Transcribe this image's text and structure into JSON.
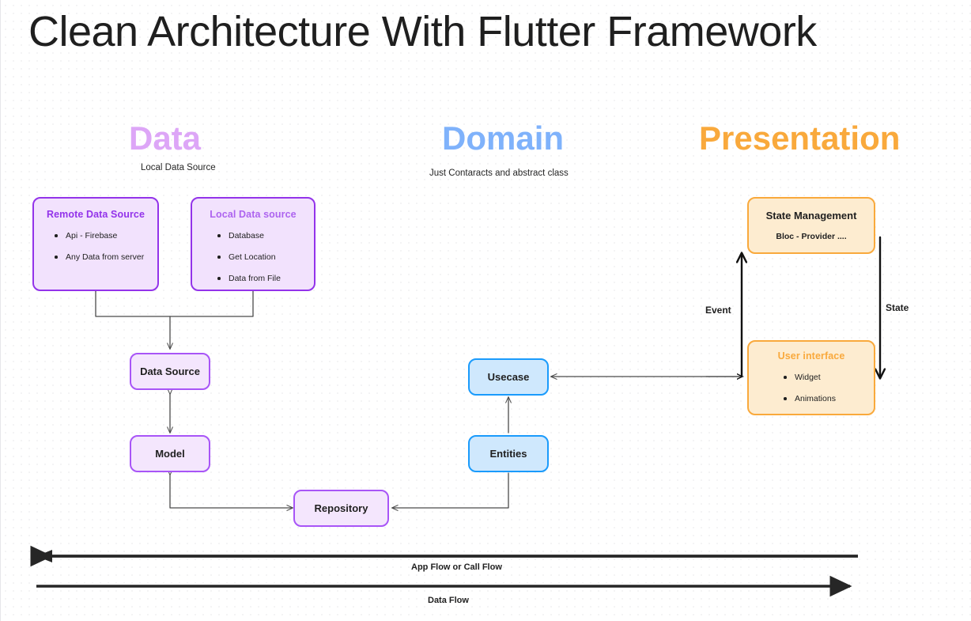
{
  "page": {
    "title": "Clean Architecture With Flutter Framework"
  },
  "columns": [
    {
      "heading": "Data",
      "subtitle": "Local Data Source",
      "color": "#dda6f7"
    },
    {
      "heading": "Domain",
      "subtitle": "Just Contaracts and abstract class",
      "color": "#7fb2fb"
    },
    {
      "heading": "Presentation",
      "subtitle": "",
      "color": "#f9a93c"
    }
  ],
  "nodes": {
    "remote_data_source": {
      "title": "Remote Data Source",
      "items": [
        "Api  - Firebase",
        "Any Data from server"
      ]
    },
    "local_data_source": {
      "title": "Local Data source",
      "items": [
        "Database",
        "Get Location",
        "Data from File"
      ]
    },
    "data_source": {
      "title": "Data Source"
    },
    "model": {
      "title": "Model"
    },
    "repository": {
      "title": "Repository"
    },
    "usecase": {
      "title": "Usecase"
    },
    "entities": {
      "title": "Entities"
    },
    "state_management": {
      "title": "State Management",
      "subtitle": "Bloc - Provider ...."
    },
    "user_interface": {
      "title": "User interface",
      "items": [
        "Widget",
        "Animations"
      ]
    }
  },
  "edge_labels": {
    "event": "Event",
    "state": "State"
  },
  "flows": [
    {
      "label": "App Flow or Call Flow",
      "direction": "left"
    },
    {
      "label": "Data Flow",
      "direction": "right"
    }
  ]
}
